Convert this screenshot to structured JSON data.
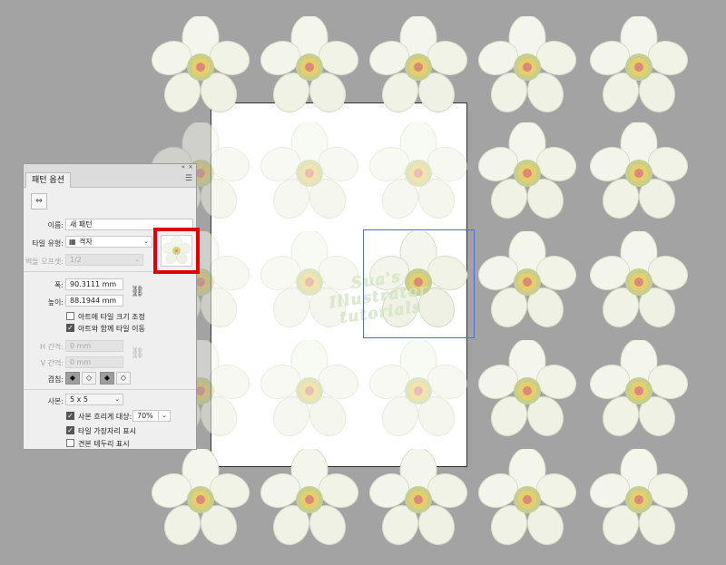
{
  "panel": {
    "title_controls": {
      "collapse": "«",
      "close": "×"
    },
    "tab_label": "패턴 옵션",
    "menu_icon": "hamburger-menu-icon",
    "tool_icon": "pattern-tile-tool-icon",
    "name_label": "이름:",
    "name_value": "새 패턴",
    "tile_type_label": "타일 유형:",
    "tile_type_value": "격자",
    "brick_offset_label": "벽돌 오프셋:",
    "brick_offset_value": "1/2",
    "width_label": "폭:",
    "width_value": "90.3111 mm",
    "height_label": "높이:",
    "height_value": "88.1944 mm",
    "size_tile_to_art_label": "아트에 타일 크기 조정",
    "size_tile_to_art_checked": false,
    "move_tile_with_art_label": "아트와 함께 타일 이동",
    "move_tile_with_art_checked": true,
    "h_spacing_label": "H 간격:",
    "h_spacing_value": "0 mm",
    "v_spacing_label": "V 간격:",
    "v_spacing_value": "0 mm",
    "overlap_label": "겹침:",
    "copies_label": "사본:",
    "copies_value": "5 x 5",
    "dim_copies_label": "사본 흐리게 대상:",
    "dim_copies_checked": true,
    "dim_copies_value": "70%",
    "show_tile_edge_label": "타일 가장자리 표시",
    "show_tile_edge_checked": true,
    "show_swatch_bounds_label": "견본 테두리 표시",
    "show_swatch_bounds_checked": false
  },
  "watermark": [
    "Sua's",
    "Illustrator",
    "tutorials"
  ],
  "colors": {
    "canvas_bg": "#a3a3a3",
    "highlight_border": "#e00000",
    "tile_edge": "#4a6ee0"
  }
}
